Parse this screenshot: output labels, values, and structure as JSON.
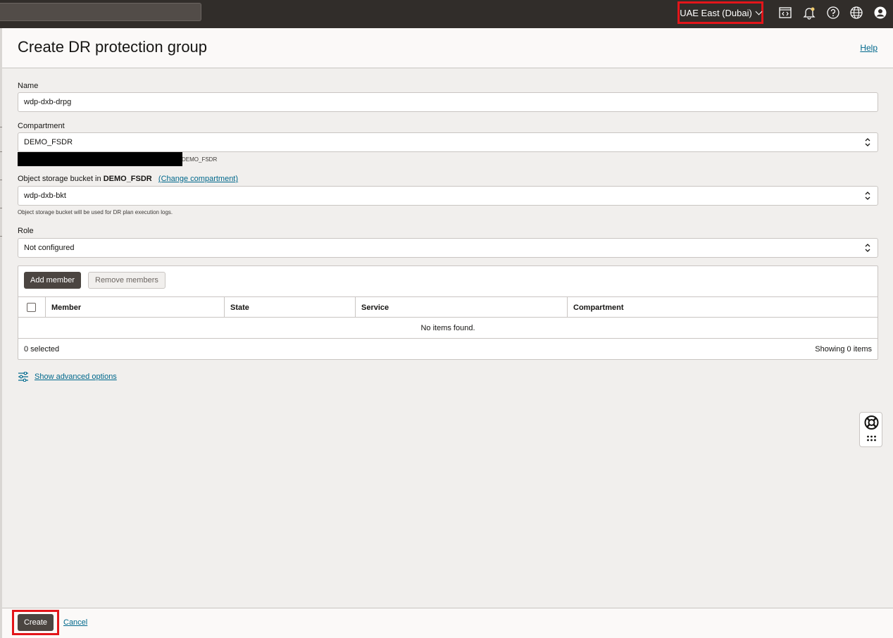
{
  "topbar": {
    "search_placeholder": "",
    "region": "UAE East (Dubai)",
    "icons": [
      "code-editor-icon",
      "bell-icon",
      "help-icon",
      "globe-icon",
      "user-icon"
    ]
  },
  "header": {
    "title": "Create DR protection group",
    "help_label": "Help"
  },
  "form": {
    "name_label": "Name",
    "name_value": "wdp-dxb-drpg",
    "compartment_label": "Compartment",
    "compartment_value": "DEMO_FSDR",
    "compartment_path_suffix": "DEMO_FSDR",
    "bucket_label_prefix": "Object storage bucket in",
    "bucket_label_compartment": "DEMO_FSDR",
    "change_compartment_link": "(Change compartment)",
    "bucket_value": "wdp-dxb-bkt",
    "bucket_hint": "Object storage bucket will be used for DR plan execution logs.",
    "role_label": "Role",
    "role_value": "Not configured"
  },
  "members": {
    "add_label": "Add member",
    "remove_label": "Remove members",
    "columns": [
      "Member",
      "State",
      "Service",
      "Compartment"
    ],
    "empty_text": "No items found.",
    "selected_text": "0 selected",
    "showing_text": "Showing 0 items"
  },
  "advanced_options_label": "Show advanced options",
  "footer": {
    "create_label": "Create",
    "cancel_label": "Cancel"
  },
  "colors": {
    "topbar": "#312d2a",
    "link": "#00688c",
    "highlight": "#e3151a",
    "primary_button": "#4b4541"
  }
}
